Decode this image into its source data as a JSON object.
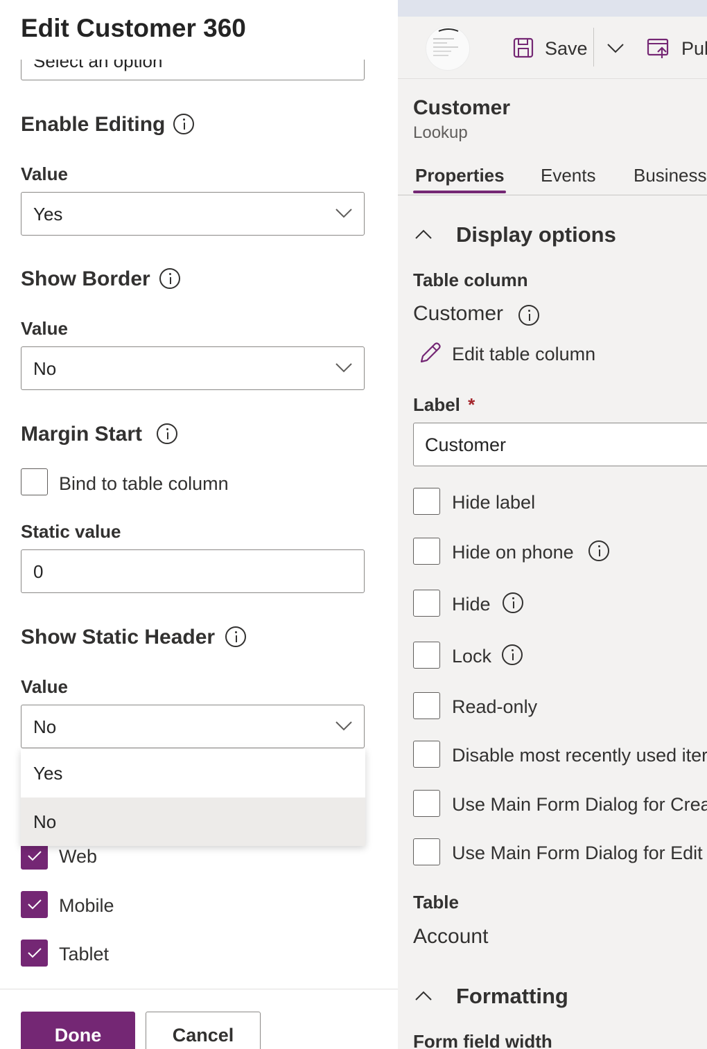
{
  "left_panel": {
    "title": "Edit Customer 360",
    "partial_select_text": "Select an option",
    "enable_editing": {
      "heading": "Enable Editing",
      "value_label": "Value",
      "value": "Yes"
    },
    "show_border": {
      "heading": "Show Border",
      "value_label": "Value",
      "value": "No"
    },
    "margin_start": {
      "heading": "Margin Start",
      "bind_label": "Bind to table column",
      "bind_checked": false,
      "static_label": "Static value",
      "static_value": "0"
    },
    "show_static_header": {
      "heading": "Show Static Header",
      "value_label": "Value",
      "value": "No"
    },
    "dropdown_options": [
      {
        "label": "Yes",
        "selected": false
      },
      {
        "label": "No",
        "selected": true
      }
    ],
    "platforms": [
      {
        "label": "Web",
        "checked": true
      },
      {
        "label": "Mobile",
        "checked": true
      },
      {
        "label": "Tablet",
        "checked": true
      }
    ],
    "done_label": "Done",
    "cancel_label": "Cancel"
  },
  "right_panel": {
    "command_bar": {
      "save_label": "Save",
      "publish_label": "Pub"
    },
    "field_title": "Customer",
    "field_type": "Lookup",
    "tabs": [
      {
        "label": "Properties",
        "active": true
      },
      {
        "label": "Events",
        "active": false
      },
      {
        "label": "Business",
        "active": false
      }
    ],
    "display_options": {
      "heading": "Display options",
      "table_column_label": "Table column",
      "table_column_value": "Customer",
      "edit_column_link": "Edit table column",
      "label_label": "Label",
      "required_mark": "*",
      "label_value": "Customer",
      "checkboxes": [
        {
          "label": "Hide label",
          "info": false
        },
        {
          "label": "Hide on phone",
          "info": true
        },
        {
          "label": "Hide",
          "info": true
        },
        {
          "label": "Lock",
          "info": true
        },
        {
          "label": "Read-only",
          "info": false
        },
        {
          "label": "Disable most recently used iter",
          "info": false
        },
        {
          "label": "Use Main Form Dialog for Crea",
          "info": false
        },
        {
          "label": "Use Main Form Dialog for Edit",
          "info": false
        }
      ],
      "table_label": "Table",
      "table_value": "Account"
    },
    "formatting": {
      "heading": "Formatting",
      "form_field_width_label": "Form field width"
    }
  },
  "colors": {
    "accent": "#742774",
    "panel_bg": "#f3f2f1",
    "border": "#8a8886",
    "selected_option_bg": "#edebe9"
  },
  "icons": [
    "info-icon",
    "chevron-down-icon",
    "chevron-up-icon",
    "save-icon",
    "publish-icon",
    "pencil-icon",
    "checkmark-icon"
  ]
}
